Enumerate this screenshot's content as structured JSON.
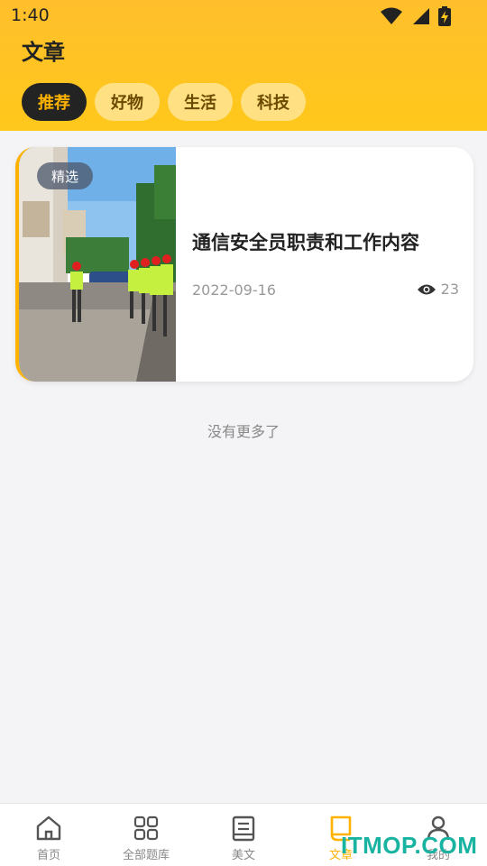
{
  "status_bar": {
    "time": "1:40",
    "icons": [
      "wifi-icon",
      "signal-icon",
      "battery-charging-icon"
    ]
  },
  "header": {
    "title": "文章"
  },
  "category_tabs": [
    {
      "label": "推荐",
      "active": true
    },
    {
      "label": "好物",
      "active": false
    },
    {
      "label": "生活",
      "active": false
    },
    {
      "label": "科技",
      "active": false
    }
  ],
  "article": {
    "badge": "精选",
    "title": "通信安全员职责和工作内容",
    "date": "2022-09-16",
    "views": "23"
  },
  "list_footer": "没有更多了",
  "bottom_nav": [
    {
      "label": "首页",
      "icon": "home-icon",
      "active": false
    },
    {
      "label": "全部题库",
      "icon": "grid-icon",
      "active": false
    },
    {
      "label": "美文",
      "icon": "book-icon",
      "active": false
    },
    {
      "label": "文章",
      "icon": "article-icon",
      "active": true
    },
    {
      "label": "我的",
      "icon": "user-icon",
      "active": false
    }
  ],
  "watermark": "ITMOP.COM",
  "colors": {
    "accent": "#ffb300",
    "header_bg": "#ffc81b",
    "active_tab_bg": "#232323",
    "watermark": "#19b3a1"
  }
}
